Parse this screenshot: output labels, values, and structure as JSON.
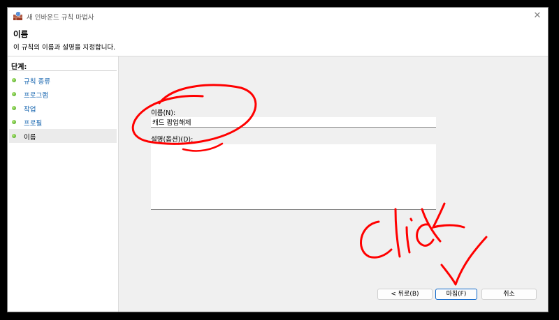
{
  "window": {
    "title": "새 인바운드 규칙 마법사",
    "close_glyph": "✕"
  },
  "header": {
    "title": "이름",
    "description": "이 규칙의 이름과 설명을 지정합니다."
  },
  "steps": {
    "heading": "단계:",
    "items": [
      {
        "label": "규칙 종류"
      },
      {
        "label": "프로그램"
      },
      {
        "label": "작업"
      },
      {
        "label": "프로필"
      },
      {
        "label": "이름",
        "current": true
      }
    ]
  },
  "form": {
    "name_label": "이름(N):",
    "name_value": "캐드 팝업해제",
    "description_label": "설명(옵션)(D):",
    "description_value": ""
  },
  "buttons": {
    "back": "< 뒤로(B)",
    "finish": "마침(F)",
    "cancel": "취소"
  },
  "annotation": {
    "color": "#ff0000",
    "text": "Click",
    "note": "red freehand circle around name field and checkmark arrow pointing to finish button"
  }
}
